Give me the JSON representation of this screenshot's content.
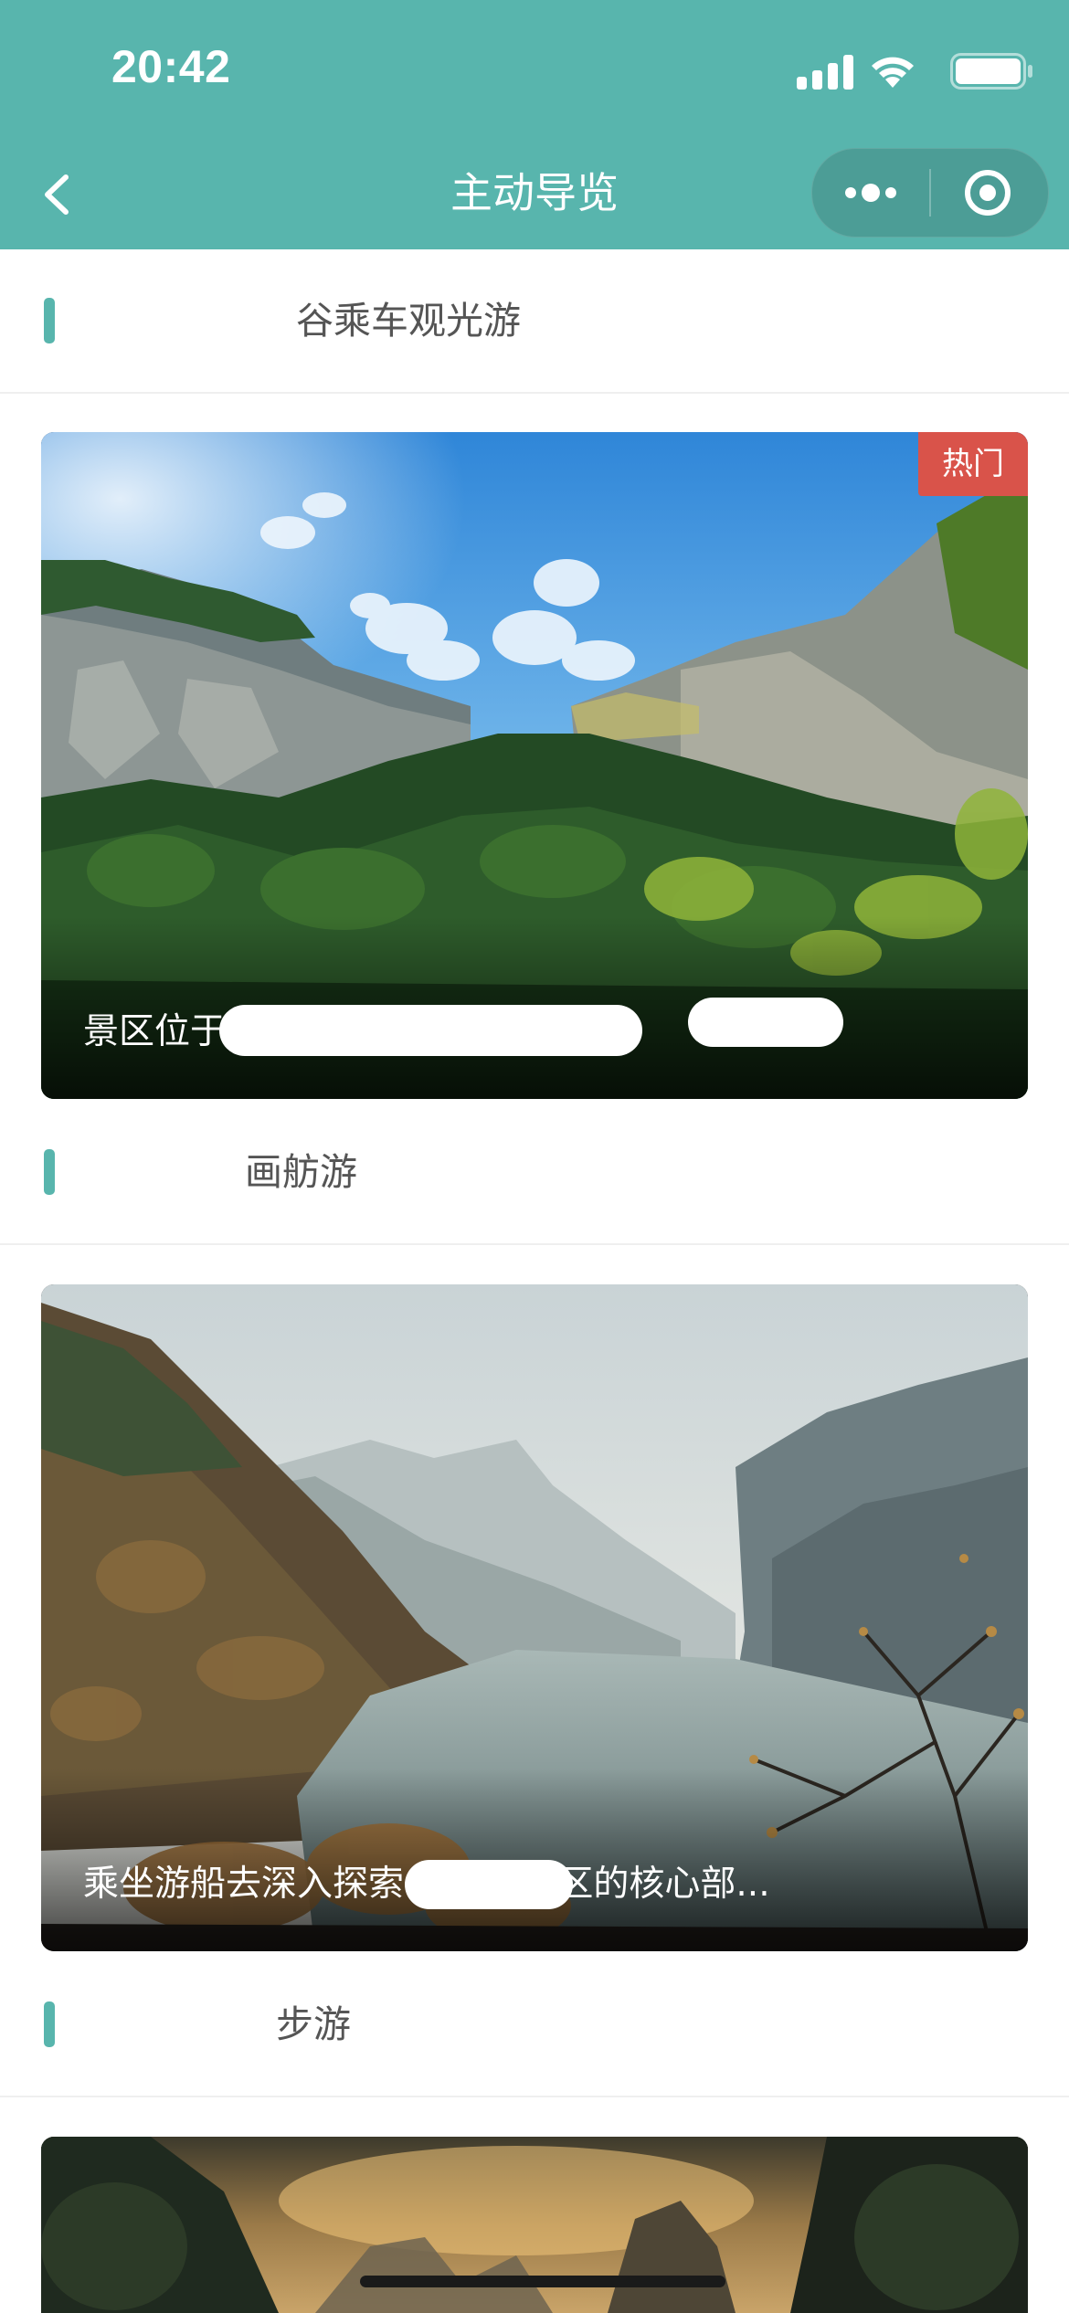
{
  "status_bar": {
    "time": "20:42"
  },
  "nav": {
    "title": "主动导览"
  },
  "sections": [
    {
      "title": "谷乘车观光游",
      "badge": "热门",
      "caption": "景区位于                                   界处，                  中段..."
    },
    {
      "title": "画舫游",
      "caption": "乘坐游船去深入探索                裂谷风景区的核心部..."
    },
    {
      "title": "步游"
    }
  ],
  "colors": {
    "accent": "#58b5ad",
    "badge": "#d9534a"
  }
}
